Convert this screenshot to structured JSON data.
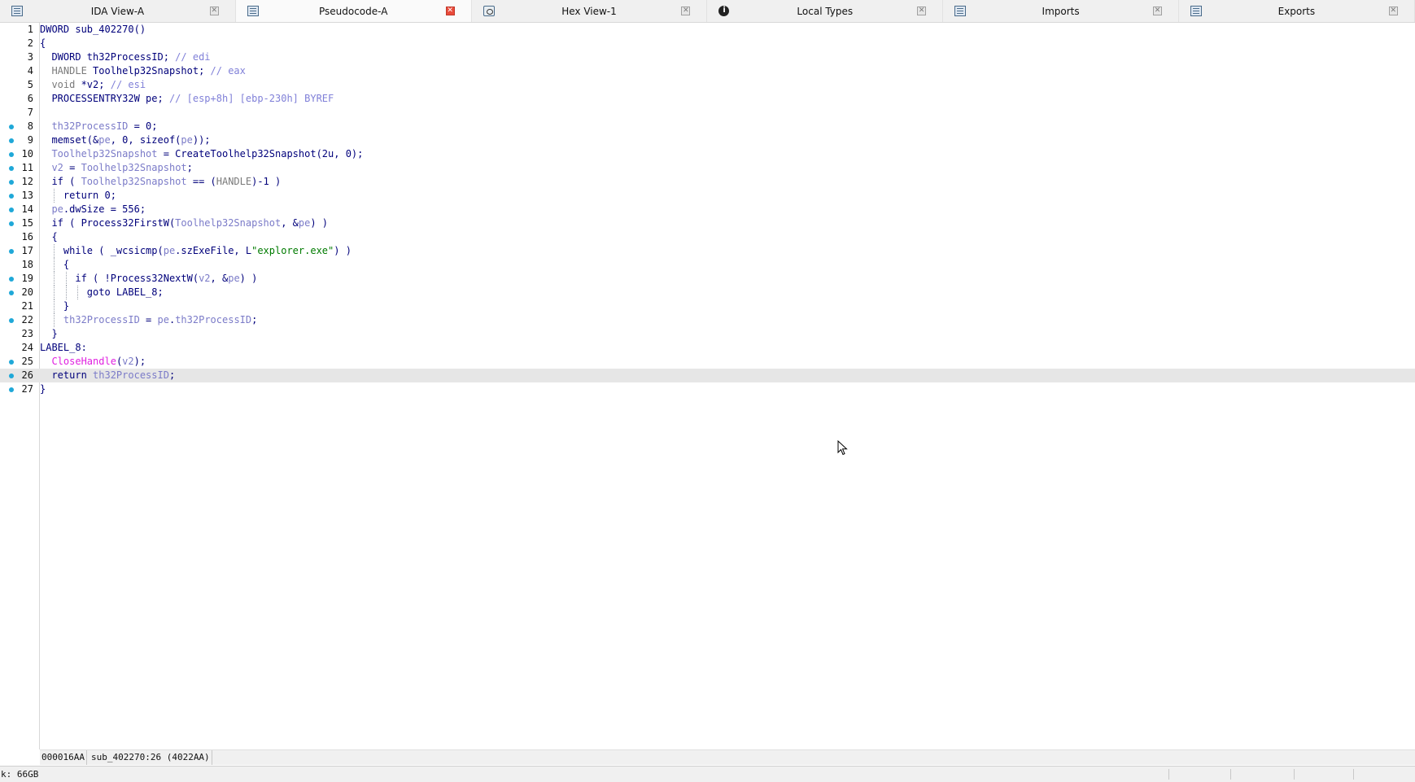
{
  "tabs": [
    {
      "label": "IDA View-A",
      "icon": "ida-view-icon",
      "active": false
    },
    {
      "label": "Pseudocode-A",
      "icon": "pseudocode-icon",
      "active": true
    },
    {
      "label": "Hex View-1",
      "icon": "hex-view-icon",
      "active": false
    },
    {
      "label": "Local Types",
      "icon": "local-types-icon",
      "active": false
    },
    {
      "label": "Imports",
      "icon": "imports-icon",
      "active": false
    },
    {
      "label": "Exports",
      "icon": "exports-icon",
      "active": false
    }
  ],
  "code": {
    "lines": [
      {
        "n": "1",
        "bp": false,
        "t": "DWORD sub_402270()"
      },
      {
        "n": "2",
        "bp": false,
        "t": "{"
      },
      {
        "n": "3",
        "bp": false,
        "t": "  DWORD th32ProcessID; // edi"
      },
      {
        "n": "4",
        "bp": false,
        "t": "  HANDLE Toolhelp32Snapshot; // eax"
      },
      {
        "n": "5",
        "bp": false,
        "t": "  void *v2; // esi"
      },
      {
        "n": "6",
        "bp": false,
        "t": "  PROCESSENTRY32W pe; // [esp+8h] [ebp-230h] BYREF"
      },
      {
        "n": "7",
        "bp": false,
        "t": ""
      },
      {
        "n": "8",
        "bp": true,
        "t": "  th32ProcessID = 0;"
      },
      {
        "n": "9",
        "bp": true,
        "t": "  memset(&pe, 0, sizeof(pe));"
      },
      {
        "n": "10",
        "bp": true,
        "t": "  Toolhelp32Snapshot = CreateToolhelp32Snapshot(2u, 0);"
      },
      {
        "n": "11",
        "bp": true,
        "t": "  v2 = Toolhelp32Snapshot;"
      },
      {
        "n": "12",
        "bp": true,
        "t": "  if ( Toolhelp32Snapshot == (HANDLE)-1 )"
      },
      {
        "n": "13",
        "bp": true,
        "t": "    return 0;"
      },
      {
        "n": "14",
        "bp": true,
        "t": "  pe.dwSize = 556;"
      },
      {
        "n": "15",
        "bp": true,
        "t": "  if ( Process32FirstW(Toolhelp32Snapshot, &pe) )"
      },
      {
        "n": "16",
        "bp": false,
        "t": "  {"
      },
      {
        "n": "17",
        "bp": true,
        "t": "    while ( _wcsicmp(pe.szExeFile, L\"explorer.exe\") )"
      },
      {
        "n": "18",
        "bp": false,
        "t": "    {"
      },
      {
        "n": "19",
        "bp": true,
        "t": "      if ( !Process32NextW(v2, &pe) )"
      },
      {
        "n": "20",
        "bp": true,
        "t": "        goto LABEL_8;"
      },
      {
        "n": "21",
        "bp": false,
        "t": "    }"
      },
      {
        "n": "22",
        "bp": true,
        "t": "    th32ProcessID = pe.th32ProcessID;"
      },
      {
        "n": "23",
        "bp": false,
        "t": "  }"
      },
      {
        "n": "24",
        "bp": false,
        "t": "LABEL_8:"
      },
      {
        "n": "25",
        "bp": true,
        "t": "  CloseHandle(v2);"
      },
      {
        "n": "26",
        "bp": true,
        "t": "  return th32ProcessID;"
      },
      {
        "n": "27",
        "bp": true,
        "t": "}"
      }
    ],
    "highlighted_line": "26"
  },
  "status": {
    "address": "000016AA",
    "location": "sub_402270:26 (4022AA)"
  },
  "bottom": {
    "disk": "k: 66GB"
  },
  "colors": {
    "breakpoint": "#1fa8d8",
    "keyword": "#00007b",
    "comment": "#8080d8",
    "string": "#007b00",
    "import_call": "#e020e0",
    "active_tab_close": "#e94a3a"
  }
}
